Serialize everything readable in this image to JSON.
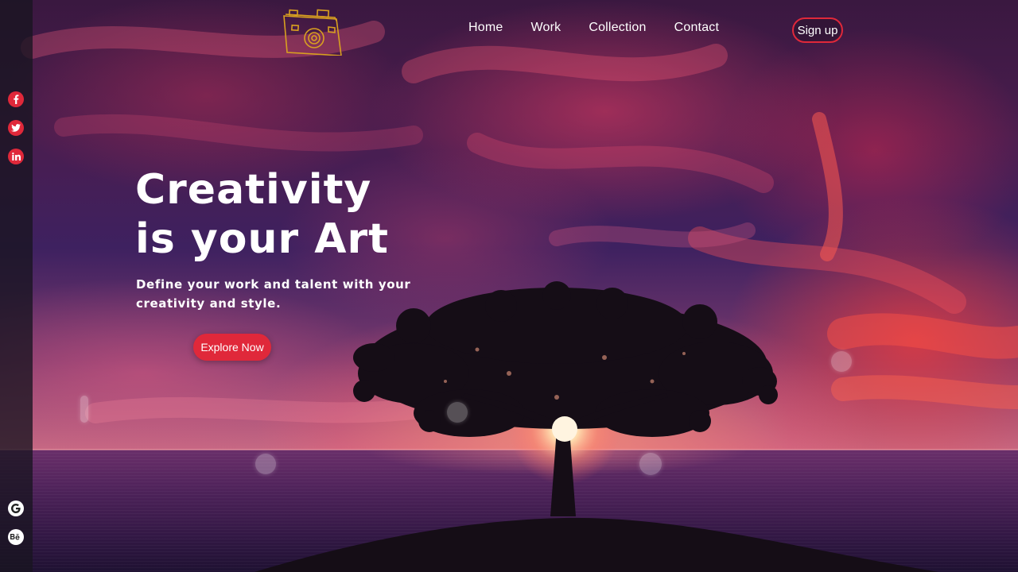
{
  "brand": {
    "logo_icon": "camera-icon",
    "accent_color": "#e0283a"
  },
  "nav": {
    "items": [
      {
        "label": "Home"
      },
      {
        "label": "Work"
      },
      {
        "label": "Collection"
      },
      {
        "label": "Contact"
      }
    ],
    "signup_label": "Sign up"
  },
  "hero": {
    "headline_line1": "Creativity",
    "headline_line2": "is your Art",
    "subtitle": "Define your work and talent with your creativity and style.",
    "cta_label": "Explore Now"
  },
  "social": {
    "top": [
      "facebook-icon",
      "twitter-icon",
      "linkedin-icon"
    ],
    "bottom": [
      "google-icon",
      "behance-icon"
    ]
  }
}
